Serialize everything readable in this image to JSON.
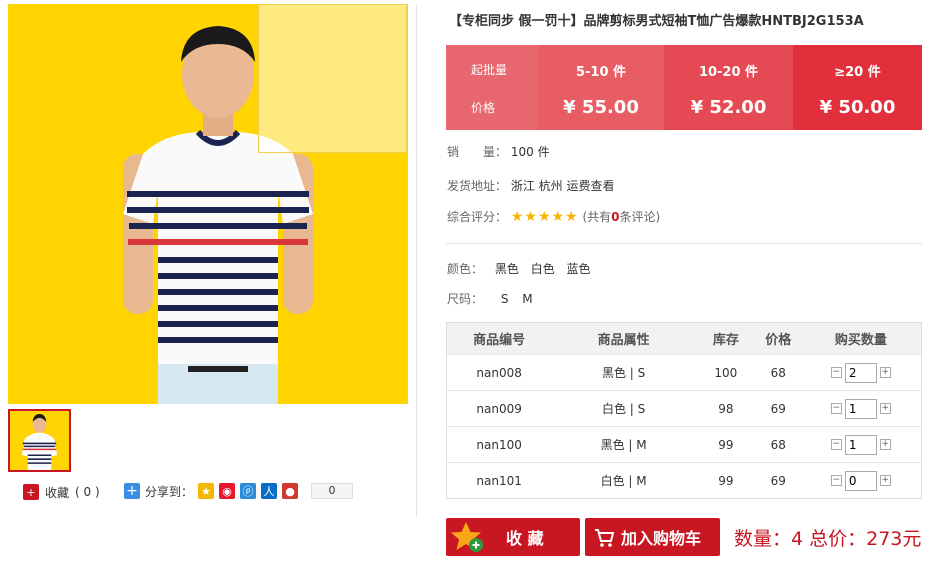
{
  "product": {
    "title": "【专柜同步 假一罚十】品牌剪标男式短袖T恤广告爆款HNTBJ2G153A"
  },
  "price_table": {
    "label_qty": "起批量",
    "label_price": "价格",
    "tiers": [
      {
        "qty": "5-10 件",
        "price": "¥ 55.00",
        "color": "#e85c64"
      },
      {
        "qty": "10-20 件",
        "price": "¥ 52.00",
        "color": "#e54a54"
      },
      {
        "qty": "≥20 件",
        "price": "¥ 50.00",
        "color": "#e12f3c"
      }
    ],
    "label_color": "#e8666d"
  },
  "sales": {
    "label": "销　　量：",
    "value": "100 件"
  },
  "shipping": {
    "label": "发货地址：",
    "value": "浙江 杭州 运费查看"
  },
  "rating": {
    "label": "综合评分：",
    "stars": 5,
    "prefix": "(共有",
    "count": "0",
    "suffix": "条评论)"
  },
  "color_opt": {
    "label": "颜色：",
    "options": [
      "黑色",
      "白色",
      "蓝色"
    ]
  },
  "size_opt": {
    "label": "尺码：",
    "options": [
      "S",
      "M"
    ]
  },
  "sku": {
    "headers": [
      "商品编号",
      "商品属性",
      "库存",
      "价格",
      "购买数量"
    ],
    "rows": [
      {
        "code": "nan008",
        "attr": "黑色 | S",
        "stock": "100",
        "price": "68",
        "qty": "2"
      },
      {
        "code": "nan009",
        "attr": "白色 | S",
        "stock": "98",
        "price": "69",
        "qty": "1"
      },
      {
        "code": "nan100",
        "attr": "黑色 | M",
        "stock": "99",
        "price": "68",
        "qty": "1"
      },
      {
        "code": "nan101",
        "attr": "白色 | M",
        "stock": "99",
        "price": "69",
        "qty": "0"
      }
    ]
  },
  "collect": {
    "label": "收藏",
    "count": "( 0 )"
  },
  "share": {
    "label": "分享到：",
    "count": "0",
    "icons": [
      "qzone-icon",
      "weibo-icon",
      "tencent-weibo-icon",
      "renren-icon",
      "kaixin-icon"
    ]
  },
  "actions": {
    "favorite": "收 藏",
    "add_cart": "加入购物车"
  },
  "summary": {
    "text": "数量：4 总价：273元"
  }
}
